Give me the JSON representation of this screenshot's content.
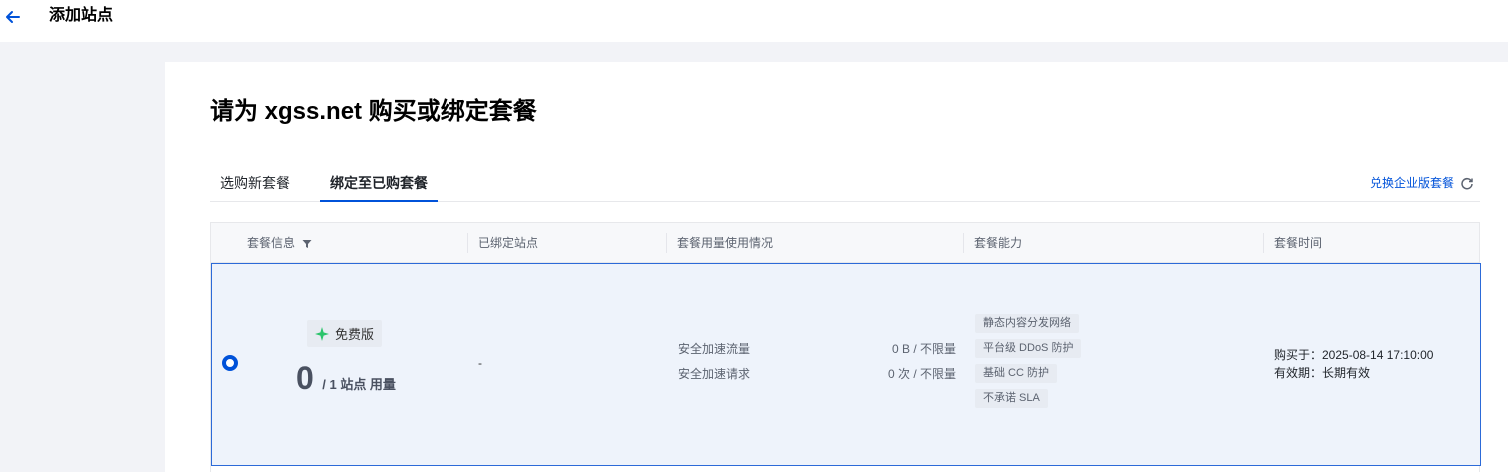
{
  "topbar": {
    "title": "添加站点"
  },
  "heading": "请为 xgss.net 购买或绑定套餐",
  "tabs": [
    {
      "label": "选购新套餐"
    },
    {
      "label": "绑定至已购套餐"
    }
  ],
  "enterprise_link": "兑换企业版套餐",
  "table": {
    "headers": [
      "套餐信息",
      "已绑定站点",
      "套餐用量使用情况",
      "套餐能力",
      "套餐时间"
    ],
    "row": {
      "plan_badge": "免费版",
      "usage_count": "0",
      "usage_suffix": "/ 1 站点 用量",
      "bound_sites": "-",
      "metrics": [
        {
          "label": "安全加速流量",
          "value": "0 B / 不限量"
        },
        {
          "label": "安全加速请求",
          "value": "0 次 / 不限量"
        }
      ],
      "capabilities": [
        "静态内容分发网络",
        "平台级 DDoS 防护",
        "基础 CC 防护",
        "不承诺 SLA"
      ],
      "purchased_at": "购买于：2025-08-14 17:10:00",
      "validity": "有效期：长期有效"
    }
  },
  "colors": {
    "accent": "#0052d9",
    "row_selected_bg": "#eef3fb",
    "badge_icon": "#2bc46b"
  }
}
